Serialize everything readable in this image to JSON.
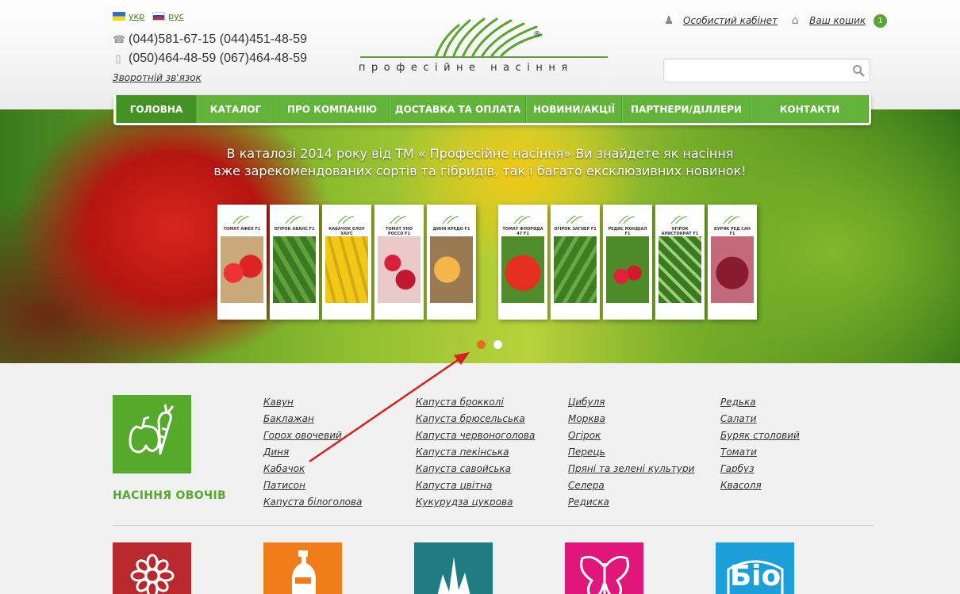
{
  "header": {
    "langs": [
      {
        "code": "ua",
        "label": "укр"
      },
      {
        "code": "ru",
        "label": "рус"
      }
    ],
    "phones": [
      {
        "icon": "phone-icon",
        "text": "(044)581-67-15 (044)451-48-59"
      },
      {
        "icon": "mobile-icon",
        "text": "(050)464-48-59 (067)464-48-59"
      }
    ],
    "callback": "Зворотній зв'язок",
    "logo_text": "професійне насіння",
    "account_label": "Особистий кабінет",
    "cart_label": "Ваш кошик",
    "cart_count": "1",
    "search_placeholder": ""
  },
  "nav": [
    {
      "label": "ГОЛОВНА",
      "active": true
    },
    {
      "label": "КАТАЛОГ"
    },
    {
      "label": "ПРО КОМПАНІЮ"
    },
    {
      "label": "ДОСТАВКА ТА ОПЛАТА"
    },
    {
      "label": "НОВИНИ/АКЦІЇ"
    },
    {
      "label": "ПАРТНЕРИ/ДІЛЛЕРИ"
    },
    {
      "label": "КОНТАКТИ"
    }
  ],
  "banner": {
    "line1": "В каталозі  2014 року  від ТМ « Професійне насіння» Ви знайдете як насіння",
    "line2": "вже зарекомендованих сортів та гібридів, так і багато ексклюзивних новинок!",
    "packets_left": [
      "ТОМАТ АФЕН F1",
      "ОГІРОК АВАНС F1",
      "КАБАЧОК ЄЛОУ ХАУС",
      "ТОМАТ УНО РОССО F1",
      "ДИНЯ КРЕДО F1"
    ],
    "packets_right": [
      "ТОМАТ ФЛОРИДА 47 F1",
      "ОГІРОК ЗАГНЕР F1",
      "РЕДИС МОНДІАЛ F1",
      "ОГІРОК АРИСТОКРАТ F1",
      "БУРЯК РЕД САН F1"
    ],
    "active_slide": 1,
    "slide_count": 2
  },
  "vegetables": {
    "title": "НАСІННЯ ОВОЧІВ",
    "columns": [
      [
        "Кавун",
        "Баклажан",
        "Горох овочевий",
        "Диня",
        "Кабачок",
        "Патисон",
        "Капуста білоголова"
      ],
      [
        "Капуста брокколі",
        "Капуста брюсельська",
        "Капуста червоноголова",
        "Капуста пекінська",
        "Капуста савойська",
        "Капуста цвітна",
        "Кукурудза цукрова"
      ],
      [
        "Цибуля",
        "Морква",
        "Огірок",
        "Перець",
        "Пряні та зелені культури",
        "Селера",
        "Редиска"
      ],
      [
        "Редька",
        "Салати",
        "Буряк столовий",
        "Томати",
        "Гарбуз",
        "Квасоля"
      ]
    ]
  },
  "categories": [
    {
      "icon": "flower-icon",
      "color": "#b8282c"
    },
    {
      "icon": "bottle-icon",
      "color": "#f07c1a"
    },
    {
      "icon": "grass-icon",
      "color": "#1f7c83"
    },
    {
      "icon": "butterfly-icon",
      "color": "#e0167a"
    },
    {
      "icon": "bio-icon",
      "color": "#1a9fd8",
      "label": "Біо"
    }
  ],
  "colors": {
    "accent": "#55a92b",
    "nav": "#62b33a",
    "annotation_arrow": "#d62020"
  }
}
